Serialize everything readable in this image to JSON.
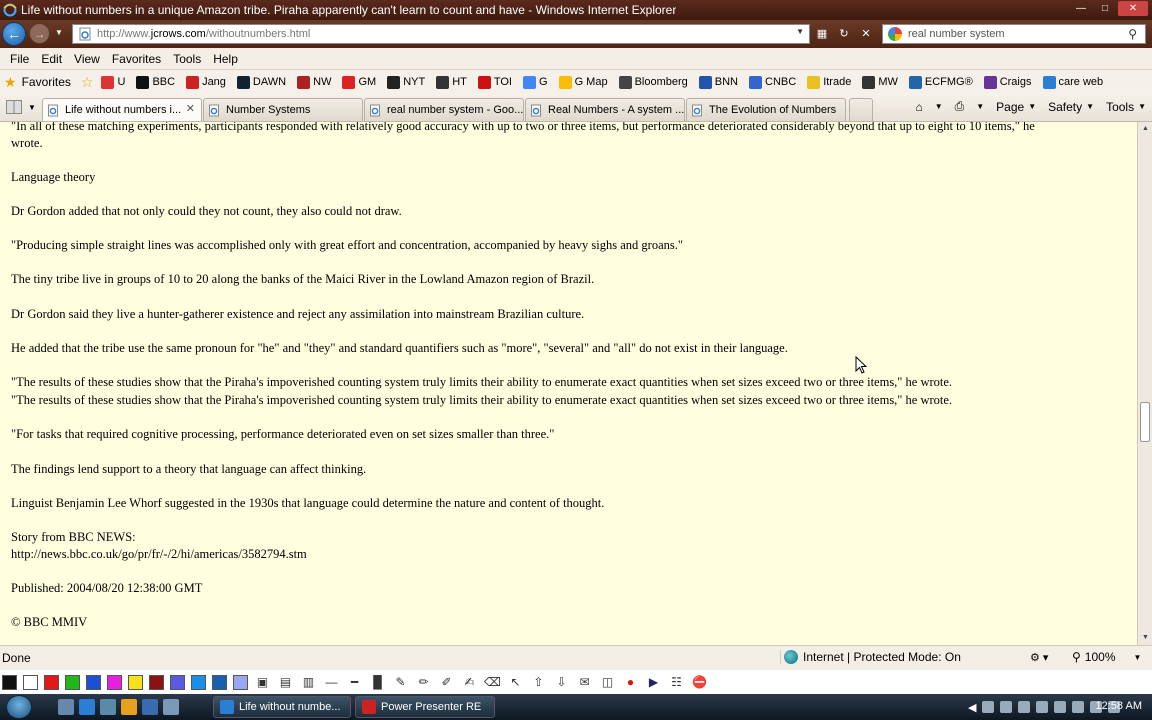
{
  "window": {
    "title": "Life without numbers in a unique Amazon tribe. Piraha apparently can't learn to count and have  - Windows Internet Explorer"
  },
  "address": {
    "url_prefix": "http://www.",
    "url_domain": "jcrows.com",
    "url_path": "/withoutnumbers.html",
    "search_value": "real number system"
  },
  "menu": {
    "items": [
      "File",
      "Edit",
      "View",
      "Favorites",
      "Tools",
      "Help"
    ]
  },
  "favorites": {
    "label": "Favorites",
    "items": [
      {
        "label": "U",
        "icon": "youtube-icon",
        "color": "#d33"
      },
      {
        "label": "BBC",
        "icon": "bbc-icon",
        "color": "#111"
      },
      {
        "label": "Jang",
        "icon": "jang-icon",
        "color": "#c22"
      },
      {
        "label": "DAWN",
        "icon": "dawn-icon",
        "color": "#123"
      },
      {
        "label": "NW",
        "icon": "nw-icon",
        "color": "#a22"
      },
      {
        "label": "GM",
        "icon": "maple-leaf-icon",
        "color": "#d22"
      },
      {
        "label": "NYT",
        "icon": "nyt-icon",
        "color": "#222"
      },
      {
        "label": "HT",
        "icon": "ht-icon",
        "color": "#333"
      },
      {
        "label": "TOI",
        "icon": "toi-icon",
        "color": "#c11"
      },
      {
        "label": "G",
        "icon": "google-icon",
        "color": "#4285f4"
      },
      {
        "label": "G Map",
        "icon": "google-maps-icon",
        "color": "#fbbc05"
      },
      {
        "label": "Bloomberg",
        "icon": "bloomberg-icon",
        "color": "#444"
      },
      {
        "label": "BNN",
        "icon": "bnn-icon",
        "color": "#25a"
      },
      {
        "label": "CNBC",
        "icon": "cnbc-icon",
        "color": "#36c"
      },
      {
        "label": "Itrade",
        "icon": "itrade-icon",
        "color": "#e8c020"
      },
      {
        "label": "MW",
        "icon": "mw-icon",
        "color": "#333"
      },
      {
        "label": "ECFMG®",
        "icon": "ecfmg-icon",
        "color": "#26a"
      },
      {
        "label": "Craigs",
        "icon": "craigs-icon",
        "color": "#639"
      },
      {
        "label": "care web",
        "icon": "ie-page-icon",
        "color": "#2a7fd4"
      }
    ]
  },
  "tabs": [
    {
      "label": "Life without numbers i...",
      "active": true
    },
    {
      "label": "Number Systems",
      "active": false
    },
    {
      "label": "real number system - Goo...",
      "active": false
    },
    {
      "label": "Real Numbers - A system ...",
      "active": false
    },
    {
      "label": "The Evolution of Numbers",
      "active": false
    }
  ],
  "commands": {
    "page": "Page",
    "safety": "Safety",
    "tools": "Tools"
  },
  "content": {
    "paragraphs": [
      "\"In all of these matching experiments, participants responded with relatively good accuracy with up to two or three items, but performance deteriorated considerably beyond that up to eight to 10 items,\" he",
      "wrote.",
      "Language theory",
      "Dr Gordon added that not only could they not count, they also could not draw.",
      "\"Producing simple straight lines was accomplished only with great effort and concentration, accompanied by heavy sighs and groans.\"",
      "The tiny tribe live in groups of 10 to 20 along the banks of the Maici River in the Lowland Amazon region of Brazil.",
      "Dr Gordon said they live a hunter-gatherer existence and reject any assimilation into mainstream Brazilian culture.",
      "He added that the tribe use the same pronoun for \"he\" and \"they\" and standard quantifiers such as \"more\", \"several\" and \"all\" do not exist in their language.",
      "\"The results of these studies show that the Piraha's impoverished counting system truly limits their ability to enumerate exact quantities when set sizes exceed two or three items,\" he wrote.",
      "\"The results of these studies show that the Piraha's impoverished counting system truly limits their ability to enumerate exact quantities when set sizes exceed two or three items,\" he wrote.",
      "\"For tasks that required cognitive processing, performance deteriorated even on set sizes smaller than three.\"",
      "The findings lend support to a theory that language can affect thinking.",
      "Linguist Benjamin Lee Whorf suggested in the 1930s that language could determine the nature and content of thought.",
      "Story from BBC NEWS:",
      "http://news.bbc.co.uk/go/pr/fr/-/2/hi/americas/3582794.stm",
      "Published: 2004/08/20 12:38:00 GMT",
      "© BBC MMIV"
    ]
  },
  "status": {
    "text": "Done",
    "zone": "Internet | Protected Mode: On",
    "zoom": "100%"
  },
  "presenter": {
    "colors": [
      "#111111",
      "#ffffff",
      "#e11919",
      "#22b51c",
      "#1a4fd6",
      "#e81ee0",
      "#f5e21a",
      "#8b1212",
      "#5a5ae0",
      "#1a8fe8",
      "#1a5fae",
      "#9aa6f0"
    ]
  },
  "taskbar": {
    "buttons": [
      {
        "label": "Life without numbe...",
        "color": "#2a7fd4"
      },
      {
        "label": "Power Presenter RE",
        "color": "#c22"
      }
    ],
    "clock": "12:58 AM"
  }
}
